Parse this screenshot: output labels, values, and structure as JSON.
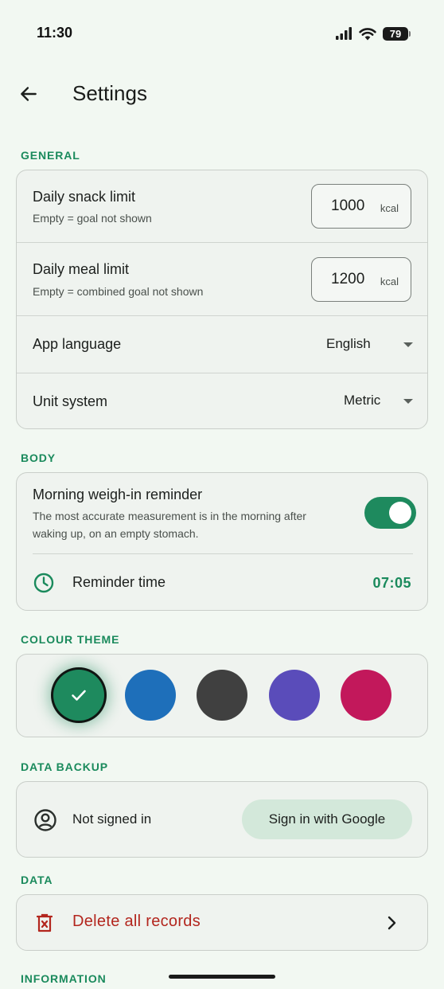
{
  "status_bar": {
    "time": "11:30",
    "battery": "79"
  },
  "header": {
    "title": "Settings"
  },
  "general": {
    "label": "GENERAL",
    "snack": {
      "title": "Daily snack limit",
      "subtitle": "Empty = goal not shown",
      "value": "1000",
      "unit": "kcal"
    },
    "meal": {
      "title": "Daily meal limit",
      "subtitle": "Empty = combined goal not shown",
      "value": "1200",
      "unit": "kcal"
    },
    "language": {
      "title": "App language",
      "value": "English"
    },
    "units": {
      "title": "Unit system",
      "value": "Metric"
    }
  },
  "body": {
    "label": "BODY",
    "reminder": {
      "title": "Morning weigh-in reminder",
      "subtitle_line1": "The most accurate measurement is in the morning after",
      "subtitle_line2": "waking up, on an empty stomach.",
      "enabled": true
    },
    "time": {
      "title": "Reminder time",
      "value": "07:05"
    }
  },
  "theme": {
    "label": "COLOUR THEME",
    "colors": [
      "#1e8a5e",
      "#1e6fba",
      "#404040",
      "#5a4cba",
      "#c2185b"
    ],
    "selected_index": 0
  },
  "backup": {
    "label": "DATA BACKUP",
    "status": "Not signed in",
    "button": "Sign in with Google"
  },
  "data": {
    "label": "DATA",
    "delete": "Delete all records"
  },
  "information": {
    "label": "INFORMATION"
  }
}
